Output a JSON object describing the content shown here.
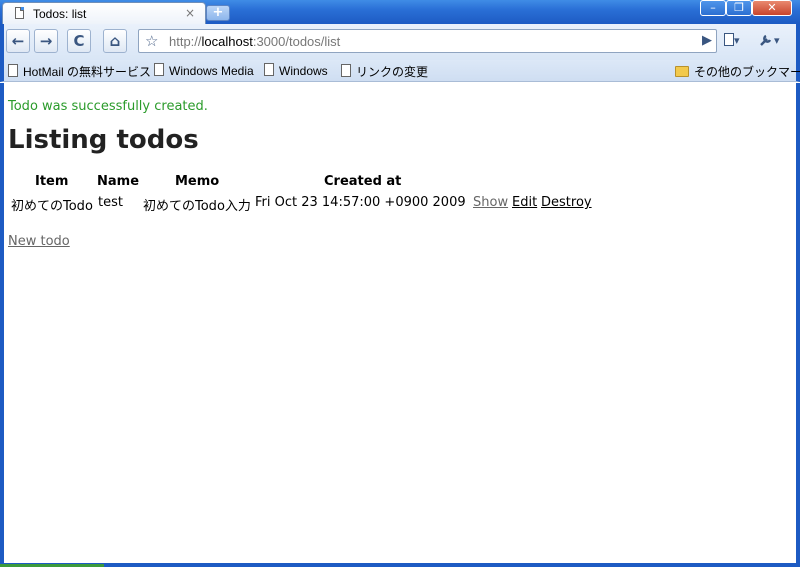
{
  "browser": {
    "tab_title": "Todos: list",
    "tab_close": "×",
    "new_tab": "+",
    "window_buttons": {
      "minimize": "–",
      "restore": "❐",
      "close": "✕"
    },
    "toolbar": {
      "back": "←",
      "forward": "→",
      "reload": "C",
      "home": "⌂",
      "star": "☆",
      "url_scheme": "http://",
      "url_host": "localhost",
      "url_rest": ":3000/todos/list",
      "go": "▶",
      "page_menu": "▾",
      "wrench_menu": "▾"
    },
    "bookmarks": [
      {
        "label": "HotMail の無料サービス",
        "type": "page"
      },
      {
        "label": "Windows Media",
        "type": "page"
      },
      {
        "label": "Windows",
        "type": "page"
      },
      {
        "label": "リンクの変更",
        "type": "page"
      }
    ],
    "other_bookmarks": "その他のブックマーク"
  },
  "page": {
    "notice": "Todo was successfully created.",
    "heading": "Listing todos",
    "table": {
      "headers": [
        "Item",
        "Name",
        "Memo",
        "Created at"
      ],
      "rows": [
        {
          "item": "初めてのTodo",
          "name": "test",
          "memo": "初めてのTodo入力",
          "created_at": "Fri Oct 23 14:57:00 +0900 2009",
          "actions": [
            "Show",
            "Edit",
            "Destroy"
          ]
        }
      ]
    },
    "new_link": "New todo"
  },
  "colors": {
    "notice": "#2a9b2a",
    "frame": "#1d5bc3",
    "visited_link": "#666666"
  }
}
